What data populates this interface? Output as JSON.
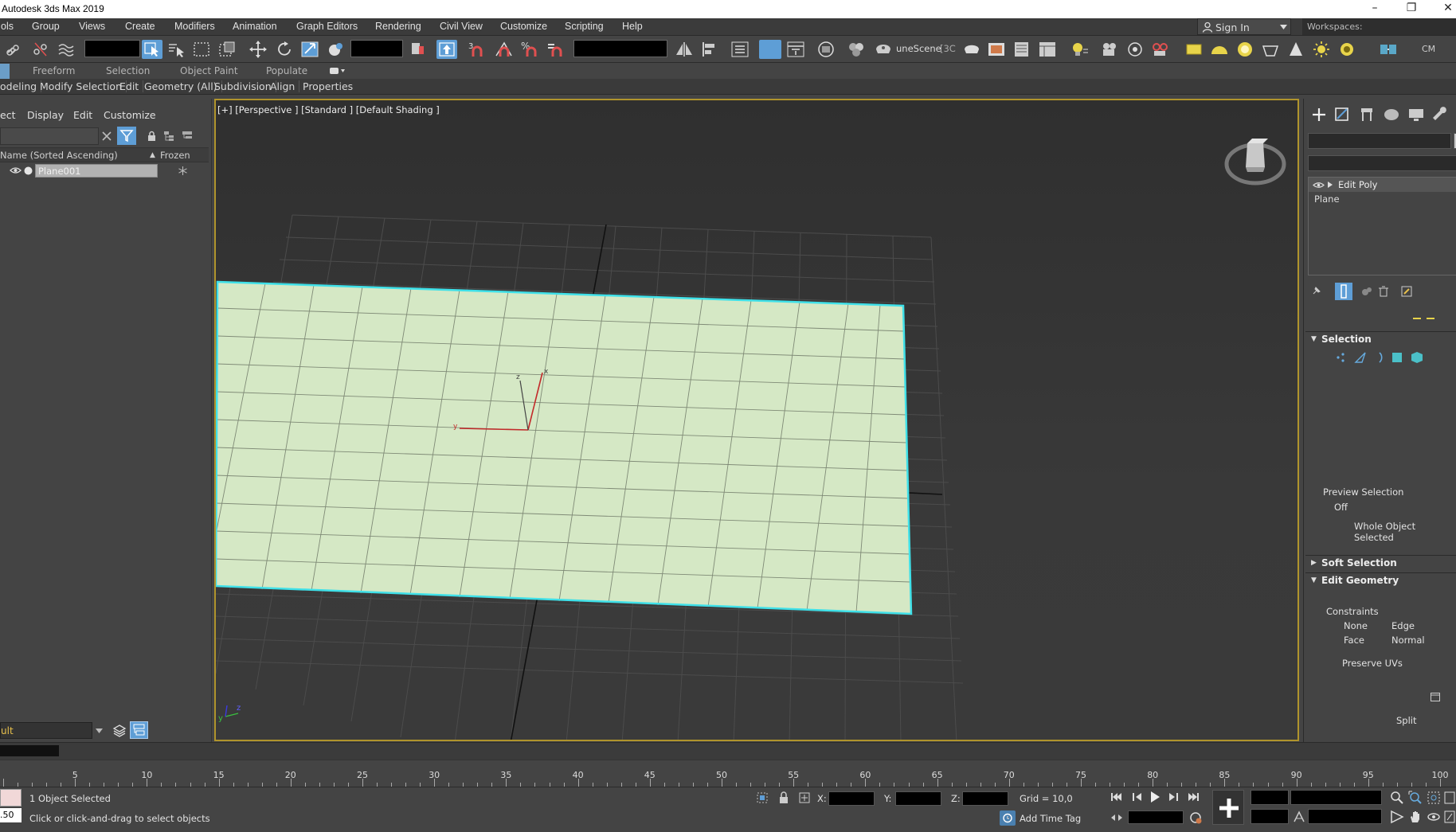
{
  "window": {
    "title": "Autodesk 3ds Max 2019",
    "minimize": "–",
    "restore": "❐",
    "close": "✕"
  },
  "menu": {
    "items": [
      "ols",
      "Group",
      "Views",
      "Create",
      "Modifiers",
      "Animation",
      "Graph Editors",
      "Rendering",
      "Civil View",
      "Customize",
      "Scripting",
      "Help"
    ],
    "sign_in": "Sign In",
    "workspaces_label": "Workspaces:"
  },
  "toolbar": {
    "scene_label": "uneScene",
    "scene_suffix": "[3C",
    "cm_label": "CM"
  },
  "ribbon": {
    "tabs": [
      "Freeform",
      "Selection",
      "Object Paint",
      "Populate"
    ],
    "panels": [
      "odeling",
      "Modify Selection",
      "Edit",
      "Geometry (All)",
      "Subdivision",
      "Align",
      "Properties"
    ]
  },
  "explorer": {
    "menu": [
      "ect",
      "Display",
      "Edit",
      "Customize"
    ],
    "col_name": "Name (Sorted Ascending)",
    "col_sort_arrow": "▲",
    "col_frozen": "Frozen",
    "rows": [
      {
        "name": "Plane001",
        "frozen_icon": "snowflake-icon"
      }
    ],
    "layer": "ult"
  },
  "viewport": {
    "label": "[+] [Perspective ] [Standard ] [Default Shading ]",
    "gizmo_axes": {
      "x": "x",
      "y": "y",
      "z": "z"
    },
    "corner_axes": {
      "y": "y",
      "z": "z"
    }
  },
  "command_panel": {
    "modifier_stack": [
      "Edit Poly",
      "Plane"
    ],
    "rollouts": {
      "selection": "Selection",
      "soft_selection": "Soft Selection",
      "edit_geometry": "Edit Geometry"
    },
    "preview_selection_label": "Preview Selection",
    "preview_selection_value": "Off",
    "whole_object": "Whole Object Selected",
    "constraints_label": "Constraints",
    "constraints": [
      "None",
      "Edge",
      "Face",
      "Normal"
    ],
    "preserve_uvs": "Preserve UVs",
    "split": "Split"
  },
  "timeline": {
    "ticks": [
      "5",
      "10",
      "15",
      "20",
      "25",
      "30",
      "35",
      "40",
      "45",
      "50",
      "55",
      "60",
      "65",
      "70",
      "75",
      "80",
      "85",
      "90",
      "95",
      "100"
    ]
  },
  "status": {
    "selection": "1 Object Selected",
    "prompt": "Click or click-and-drag to select objects",
    "x_label": "X:",
    "y_label": "Y:",
    "z_label": "Z:",
    "grid": "Grid = 10,0",
    "add_time_tag": "Add Time Tag",
    "frame_field": ".50"
  },
  "colors": {
    "viewport_border": "#b0942c",
    "plane_fill": "#d5e8c5",
    "selection_edge": "#3fe0e8",
    "active_button": "#5e9ed6",
    "layer_text": "#e8c04b"
  }
}
